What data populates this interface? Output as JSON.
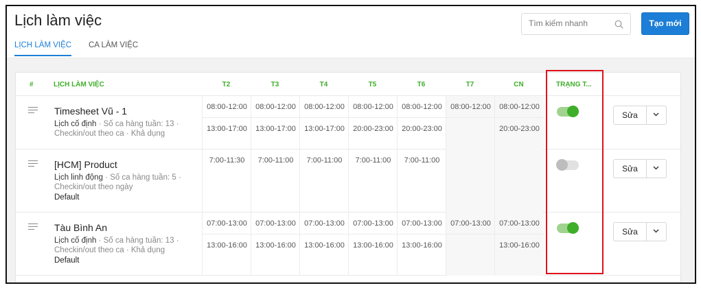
{
  "page": {
    "title": "Lịch làm việc"
  },
  "search": {
    "placeholder": "Tìm kiếm nhanh"
  },
  "actions": {
    "create_label": "Tạo mới"
  },
  "tabs": [
    {
      "label": "LỊCH LÀM VIỆC",
      "active": true
    },
    {
      "label": "CA LÀM VIỆC",
      "active": false
    }
  ],
  "table": {
    "headers": {
      "index": "#",
      "name": "LỊCH LÀM VIỆC",
      "days": [
        "T2",
        "T3",
        "T4",
        "T5",
        "T6",
        "T7",
        "CN"
      ],
      "status": "TRẠNG T..."
    },
    "rows": [
      {
        "name": "Timesheet Vũ - 1",
        "type": "Lịch cố định",
        "meta": " · Số ca hàng tuần: 13 · Checkin/out theo ca · Khả dụng",
        "extra": "",
        "slots": [
          [
            "08:00-12:00",
            "13:00-17:00"
          ],
          [
            "08:00-12:00",
            "13:00-17:00"
          ],
          [
            "08:00-12:00",
            "13:00-17:00"
          ],
          [
            "08:00-12:00",
            "20:00-23:00"
          ],
          [
            "08:00-12:00",
            "20:00-23:00"
          ],
          [
            "08:00-12:00",
            ""
          ],
          [
            "08:00-12:00",
            "20:00-23:00"
          ]
        ],
        "enabled": true,
        "edit_label": "Sửa"
      },
      {
        "name": "[HCM] Product",
        "type": "Lịch linh động",
        "meta": " · Số ca hàng tuần: 5 · Checkin/out theo ngày",
        "extra": "Default",
        "slots": [
          [
            "7:00-11:30"
          ],
          [
            "7:00-11:00"
          ],
          [
            "7:00-11:00"
          ],
          [
            "7:00-11:00"
          ],
          [
            "7:00-11:00"
          ],
          [
            ""
          ],
          [
            ""
          ]
        ],
        "enabled": false,
        "edit_label": "Sửa"
      },
      {
        "name": "Tàu Bình An",
        "type": "Lịch cố định",
        "meta": " · Số ca hàng tuần: 13 · Checkin/out theo ca · Khả dụng",
        "extra": "Default",
        "slots": [
          [
            "07:00-13:00",
            "13:00-16:00"
          ],
          [
            "07:00-13:00",
            "13:00-16:00"
          ],
          [
            "07:00-13:00",
            "13:00-16:00"
          ],
          [
            "07:00-13:00",
            "13:00-16:00"
          ],
          [
            "07:00-13:00",
            "13:00-16:00"
          ],
          [
            "07:00-13:00",
            ""
          ],
          [
            "07:00-13:00",
            "13:00-16:00"
          ]
        ],
        "enabled": true,
        "edit_label": "Sửa"
      }
    ]
  },
  "colors": {
    "primary": "#1c7ed6",
    "header_text": "#3fae2a",
    "toggle_on": "#3fae2a",
    "highlight": "#e0101a"
  }
}
